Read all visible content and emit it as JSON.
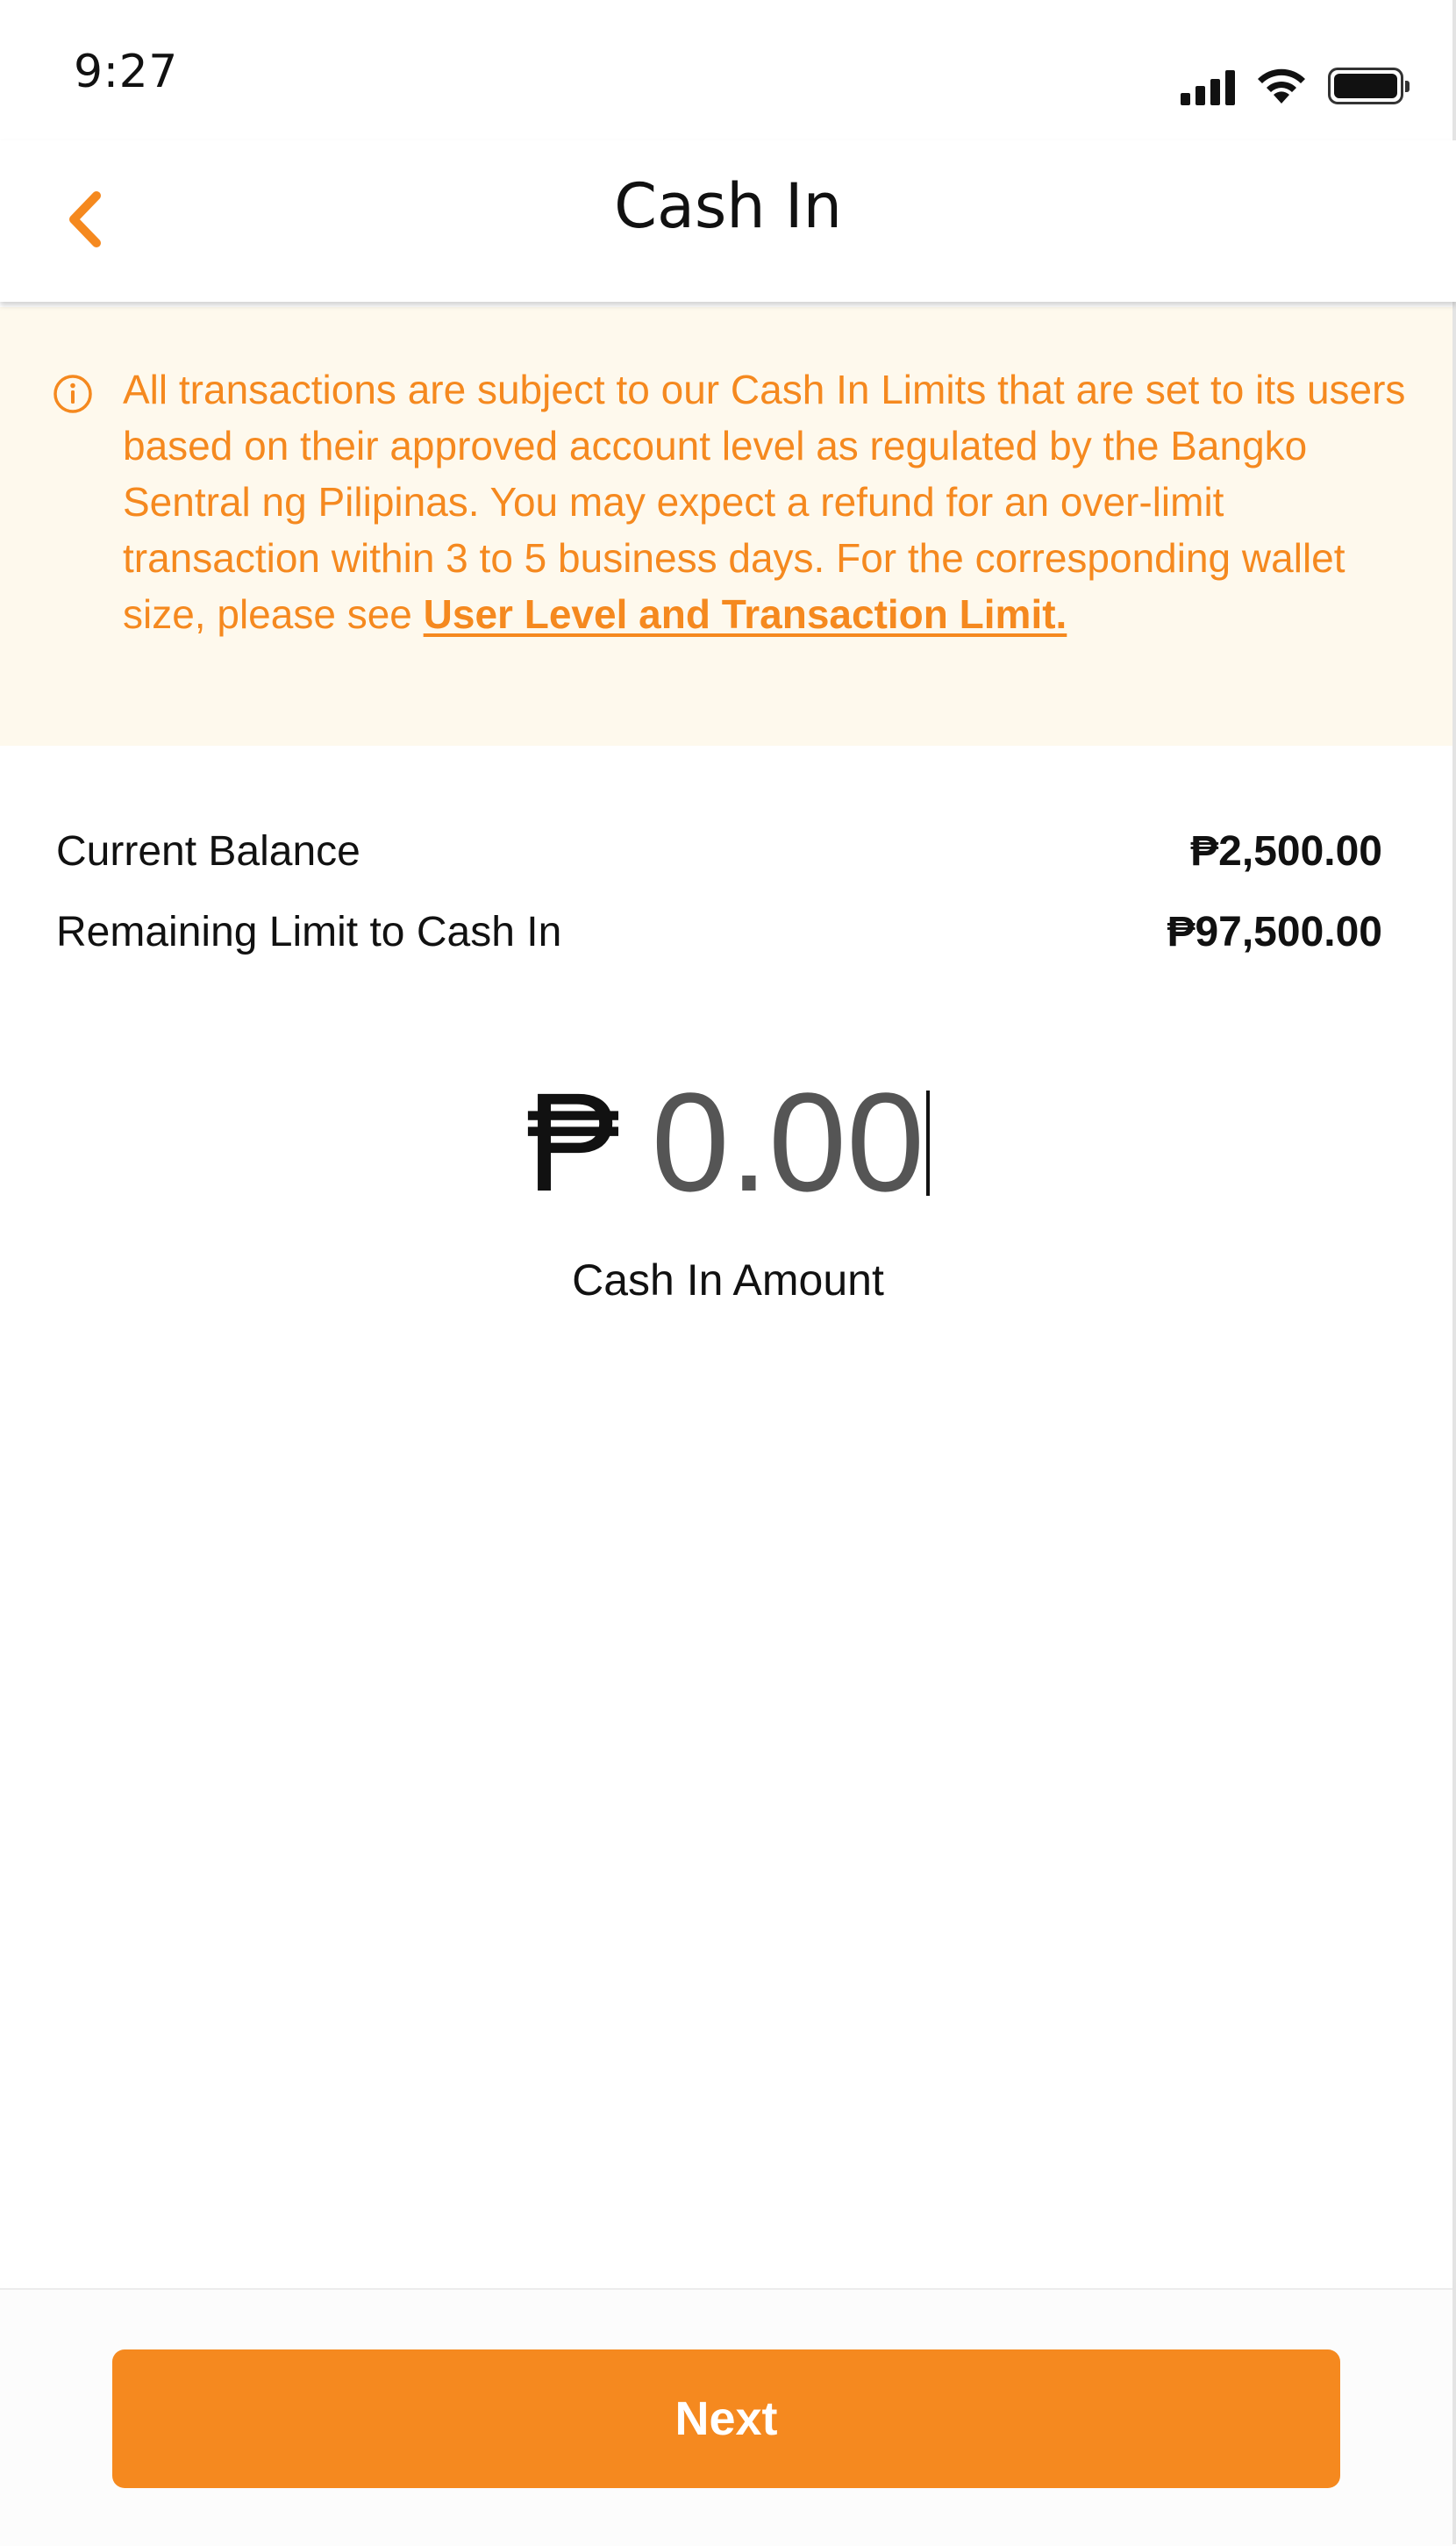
{
  "status_bar": {
    "time": "9:27"
  },
  "header": {
    "title": "Cash In",
    "back_icon": "chevron-left-icon"
  },
  "notice": {
    "icon": "info-circle-icon",
    "text": "All transactions are subject to our Cash In Limits that are set to its users based on their approved account level as regulated by the Bangko Sentral ng Pilipinas. You may expect a refund for an over-limit transaction within 3 to 5 business days. For the corresponding wallet size, please see ",
    "link_text": "User Level and Transaction Limit."
  },
  "balances": {
    "current_balance_label": "Current Balance",
    "current_balance_value": "₱2,500.00",
    "remaining_limit_label": "Remaining Limit to Cash In",
    "remaining_limit_value": "₱97,500.00"
  },
  "amount": {
    "currency_symbol": "₱",
    "value": "0.00",
    "caption": "Cash In Amount"
  },
  "footer": {
    "next_label": "Next"
  },
  "colors": {
    "accent": "#F5891F",
    "notice_background": "#FEF9ED",
    "amount_text": "#555555"
  }
}
